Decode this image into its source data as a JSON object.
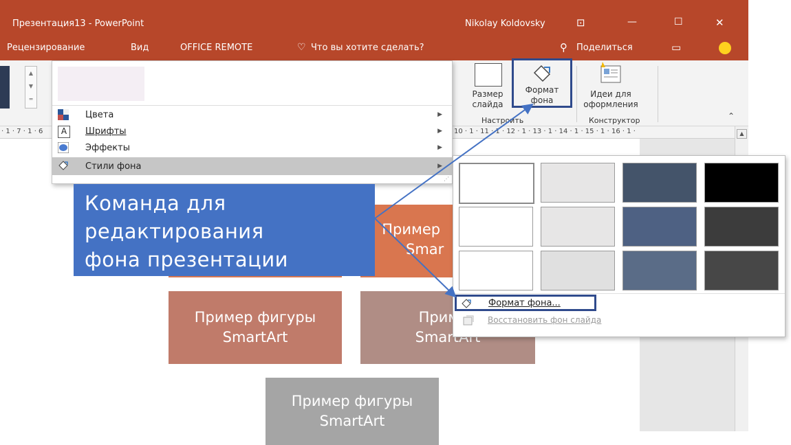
{
  "window": {
    "title": "Презентация13 - PowerPoint",
    "user": "Nikolay Koldovsky",
    "minimize": "—",
    "maximize": "☐",
    "close": "✕"
  },
  "tabs": {
    "review": "Рецензирование",
    "view": "Вид",
    "office_remote": "OFFICE REMOTE",
    "tell_me": "Что вы хотите сделать?",
    "share": "Поделиться"
  },
  "ribbon": {
    "slide_size": "Размер\nслайда",
    "format_bg": "Формат\nфона",
    "design_ideas": "Идеи для\nоформления",
    "group_customize": "Настроить",
    "group_designer": "Конструктор"
  },
  "ruler": {
    "left_ticks": "· 1 · 7 · 1 · 6",
    "right_ticks": "10 · 1 · 11 · 1 · 12 · 1 · 13 · 1 · 14 · 1 · 15 · 1 · 16 · 1 ·"
  },
  "dropdown": {
    "items": [
      {
        "label": "Цвета",
        "icon": "colors-icon"
      },
      {
        "label": "Шрифты",
        "icon": "fonts-icon"
      },
      {
        "label": "Эффекты",
        "icon": "effects-icon"
      },
      {
        "label": "Стили фона",
        "icon": "background-styles-icon"
      }
    ]
  },
  "callout": {
    "line1": "Команда для",
    "line2": "редактирования",
    "line3": "фона презентации"
  },
  "shapes": {
    "s1_line1": "Пример",
    "s1_line2": "Smar",
    "s2_line1": "Пример фигуры",
    "s2_line2": "SmartArt",
    "s3_line1": "Пример",
    "s3_line2": "SmartArt",
    "s4_line1": "Пример фигуры",
    "s4_line2": "SmartArt"
  },
  "gallery": {
    "swatches": [
      "#ffffff",
      "#e7e6e6",
      "#44546a",
      "#000000",
      "#ffffff",
      "#e7e6e6",
      "#4e6183",
      "#3c3c3c",
      "#ffffff",
      "#e0e0e0",
      "#5a6c87",
      "#474747"
    ],
    "format_background": "Формат фона...",
    "reset_background": "Восстановить фон слайда"
  },
  "colors": {
    "accent": "#b7472a",
    "highlight_border": "#2f4a8c",
    "callout": "#4472c4",
    "shape_orange": "#d9764f",
    "shape_brown": "#c07b6a",
    "shape_taupe": "#b08d85",
    "shape_gray": "#a5a5a5"
  }
}
